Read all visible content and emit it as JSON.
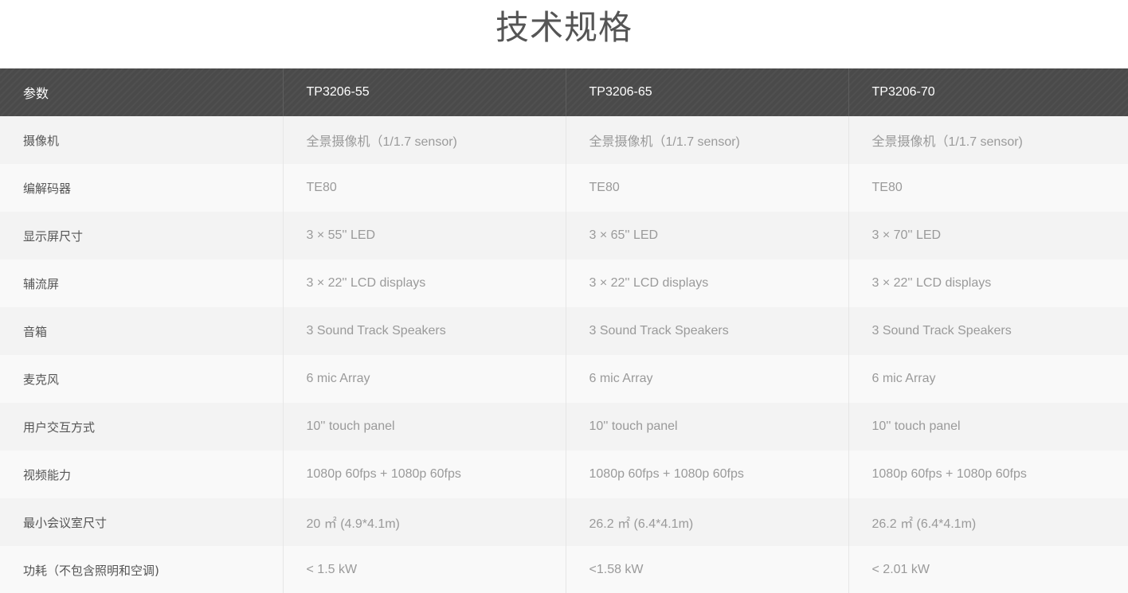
{
  "title": "技术规格",
  "table": {
    "headers": [
      "参数",
      "TP3206-55",
      "TP3206-65",
      "TP3206-70"
    ],
    "rows": [
      {
        "param": "摄像机",
        "v55": "全景摄像机（1/1.7 sensor)",
        "v65": "全景摄像机（1/1.7 sensor)",
        "v70": "全景摄像机（1/1.7 sensor)"
      },
      {
        "param": "编解码器",
        "v55": "TE80",
        "v65": "TE80",
        "v70": "TE80"
      },
      {
        "param": "显示屏尺寸",
        "v55": "3 × 55''  LED",
        "v65": "3 × 65''  LED",
        "v70": "3 × 70''  LED"
      },
      {
        "param": "辅流屏",
        "v55": "3 × 22'' LCD displays",
        "v65": "3 × 22'' LCD displays",
        "v70": "3 × 22'' LCD displays"
      },
      {
        "param": "音箱",
        "v55": "3 Sound Track Speakers",
        "v65": "3 Sound Track Speakers",
        "v70": "3 Sound Track Speakers"
      },
      {
        "param": "麦克风",
        "v55": "6 mic Array",
        "v65": "6 mic Array",
        "v70": "6 mic Array"
      },
      {
        "param": "用户交互方式",
        "v55": "10'' touch panel",
        "v65": "10'' touch panel",
        "v70": "10'' touch panel"
      },
      {
        "param": "视频能力",
        "v55": "1080p 60fps + 1080p 60fps",
        "v65": "1080p 60fps + 1080p 60fps",
        "v70": "1080p 60fps + 1080p 60fps"
      },
      {
        "param": "最小会议室尺寸",
        "v55": "20 ㎡ (4.9*4.1m)",
        "v65": "26.2 ㎡ (6.4*4.1m)",
        "v70": "26.2 ㎡ (6.4*4.1m)"
      },
      {
        "param": "功耗（不包含照明和空调)",
        "v55": "< 1.5 kW",
        "v65": "<1.58 kW",
        "v70": "< 2.01 kW"
      }
    ]
  },
  "colors": {
    "header_bg": "#4a4a4a",
    "header_text": "#ffffff",
    "row_odd": "#f3f3f3",
    "row_even": "#f9f9f9",
    "param_text": "#555555",
    "value_text": "#9a9a9a",
    "title_text": "#555555"
  }
}
